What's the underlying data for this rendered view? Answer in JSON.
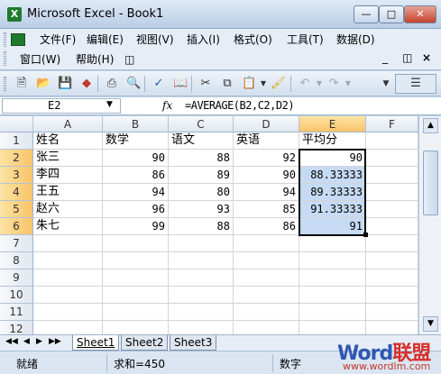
{
  "window": {
    "title": "Microsoft Excel - Book1",
    "app_icon_letter": "X",
    "min": "—",
    "max": "□",
    "close": "✕"
  },
  "menu": {
    "items": [
      "文件(F)",
      "编辑(E)",
      "视图(V)",
      "插入(I)",
      "格式(O)",
      "工具(T)",
      "数据(D)",
      "窗口(W)",
      "帮助(H)"
    ],
    "doc_controls": {
      "min": "_",
      "restore": "̅×",
      "close": "×"
    }
  },
  "toolbar": {
    "icons": [
      "new-doc-icon",
      "open-icon",
      "save-icon",
      "permission-icon",
      "print-icon",
      "print-preview-icon",
      "spelling-icon",
      "research-icon",
      "cut-icon",
      "copy-icon",
      "paste-icon",
      "format-painter-icon",
      "undo-icon",
      "redo-icon",
      "align-icon"
    ]
  },
  "formula_bar": {
    "name_box": "E2",
    "fx": "fx",
    "formula": "=AVERAGE(B2,C2,D2)"
  },
  "grid": {
    "columns": [
      "A",
      "B",
      "C",
      "D",
      "E",
      "F"
    ],
    "rows": [
      "1",
      "2",
      "3",
      "4",
      "5",
      "6",
      "7",
      "8",
      "9",
      "10",
      "11",
      "12"
    ],
    "headers": [
      "姓名",
      "数学",
      "语文",
      "英语",
      "平均分"
    ],
    "data": [
      [
        "张三",
        "90",
        "88",
        "92",
        "90"
      ],
      [
        "李四",
        "86",
        "89",
        "90",
        "88.33333"
      ],
      [
        "王五",
        "94",
        "80",
        "94",
        "89.33333"
      ],
      [
        "赵六",
        "96",
        "93",
        "85",
        "91.33333"
      ],
      [
        "朱七",
        "99",
        "88",
        "86",
        "91"
      ]
    ],
    "selected_column": "E",
    "selected_rows": [
      "2",
      "3",
      "4",
      "5",
      "6"
    ]
  },
  "sheets": {
    "tabs": [
      "Sheet1",
      "Sheet2",
      "Sheet3"
    ],
    "active": "Sheet1",
    "nav": [
      "◀◀",
      "◀",
      "▶",
      "▶▶"
    ]
  },
  "status": {
    "mode": "就绪",
    "sum": "求和=450",
    "num": "数字"
  },
  "watermark": {
    "brand_a": "Word",
    "brand_b": "联盟",
    "url": "www.wordlm.com"
  },
  "colors": {
    "selection": "#c6dbf3",
    "header_selected": "#f8c46a",
    "title_bg": "#dfeaf7"
  }
}
